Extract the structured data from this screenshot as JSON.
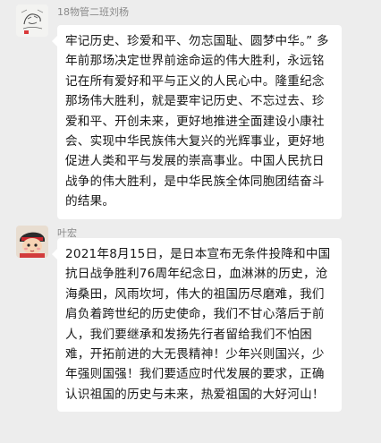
{
  "messages": [
    {
      "sender": "18物管二班刘杨",
      "avatar_icon": "sketch-portrait-avatar",
      "text": "牢记历史、珍爱和平、勿忘国耻、圆梦中华。” 多年前那场决定世界前途命运的伟大胜利，永远铭记在所有爱好和平与正义的人民心中。隆重纪念那场伟大胜利，就是要牢记历史、不忘过去、珍爱和平、开创未来，更好地推进全面建设小康社会、实现中华民族伟大复兴的光辉事业，更好地促进人类和平与发展的崇高事业。中国人民抗日战争的伟大胜利，是中华民族全体同胞团结奋斗的结果。"
    },
    {
      "sender": "叶宏",
      "avatar_icon": "cartoon-character-avatar",
      "text": "2021年8月15日，是日本宣布无条件投降和中国抗日战争胜利76周年纪念日，血淋淋的历史，沧海桑田，风雨坎坷，伟大的祖国历尽磨难，我们肩负着跨世纪的历史使命，我们不甘心落后于前人，我们要继承和发扬先行者留给我们不怕困难，开拓前进的大无畏精神！少年兴则国兴，少年强则国强！我们要适应时代发展的要求，正确认识祖国的历史与未来，热爱祖国的大好河山！"
    }
  ],
  "colors": {
    "background": "#ededed",
    "bubble": "#ffffff",
    "sender_name": "#8a8a8a",
    "text": "#191919"
  }
}
